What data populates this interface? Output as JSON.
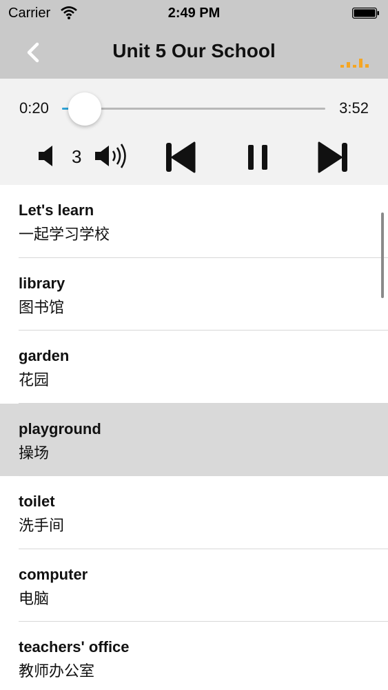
{
  "status_bar": {
    "carrier": "Carrier",
    "time": "2:49 PM",
    "icons": [
      "wifi-icon",
      "battery-icon"
    ]
  },
  "nav": {
    "title": "Unit 5 Our School",
    "back_icon": "chevron-left-icon",
    "status_icon": "equalizer-icon",
    "accent_color": "#f5a623"
  },
  "player": {
    "current_time": "0:20",
    "total_time": "3:52",
    "progress": 0.086,
    "volume": "3",
    "controls": [
      "volume-down-icon",
      "volume-up-icon",
      "previous-track-icon",
      "pause-icon",
      "next-track-icon"
    ],
    "progress_color": "#2fa3d6"
  },
  "list": {
    "items": [
      {
        "en": "Let's learn",
        "zh": "一起学习学校"
      },
      {
        "en": "library",
        "zh": "图书馆"
      },
      {
        "en": "garden",
        "zh": "花园"
      },
      {
        "en": "playground",
        "zh": "操场"
      },
      {
        "en": "toilet",
        "zh": "洗手间"
      },
      {
        "en": "computer",
        "zh": "电脑"
      },
      {
        "en": "teachers' office",
        "zh": "教师办公室"
      }
    ],
    "selected_index": 3
  }
}
